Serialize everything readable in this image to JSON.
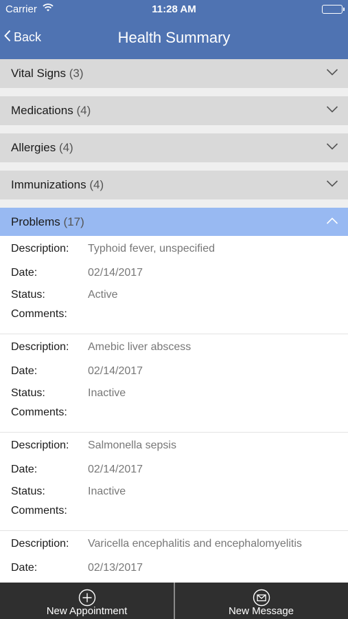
{
  "status_bar": {
    "carrier": "Carrier",
    "time": "11:28 AM"
  },
  "nav": {
    "back_label": "Back",
    "title": "Health Summary"
  },
  "sections": [
    {
      "label": "Vital Signs",
      "count": "(3)",
      "expanded": false
    },
    {
      "label": "Medications",
      "count": "(4)",
      "expanded": false
    },
    {
      "label": "Allergies",
      "count": "(4)",
      "expanded": false
    },
    {
      "label": "Immunizations",
      "count": "(4)",
      "expanded": false
    },
    {
      "label": "Problems",
      "count": "(17)",
      "expanded": true
    }
  ],
  "field_labels": {
    "description": "Description:",
    "date": "Date:",
    "status": "Status:",
    "comments": "Comments:"
  },
  "problems": [
    {
      "description": "Typhoid fever, unspecified",
      "date": "02/14/2017",
      "status": "Active",
      "comments": ""
    },
    {
      "description": "Amebic liver abscess",
      "date": "02/14/2017",
      "status": "Inactive",
      "comments": ""
    },
    {
      "description": "Salmonella sepsis",
      "date": "02/14/2017",
      "status": "Inactive",
      "comments": ""
    },
    {
      "description": "Varicella encephalitis and encephalomyelitis",
      "date": "02/13/2017",
      "status": "",
      "comments": ""
    }
  ],
  "tabs": {
    "new_appointment": "New Appointment",
    "new_message": "New Message"
  },
  "colors": {
    "nav_blue": "#4f73b2",
    "section_gray": "#d9d9d9",
    "section_active": "#98b9f2",
    "tab_bar": "#2f2f2f"
  }
}
